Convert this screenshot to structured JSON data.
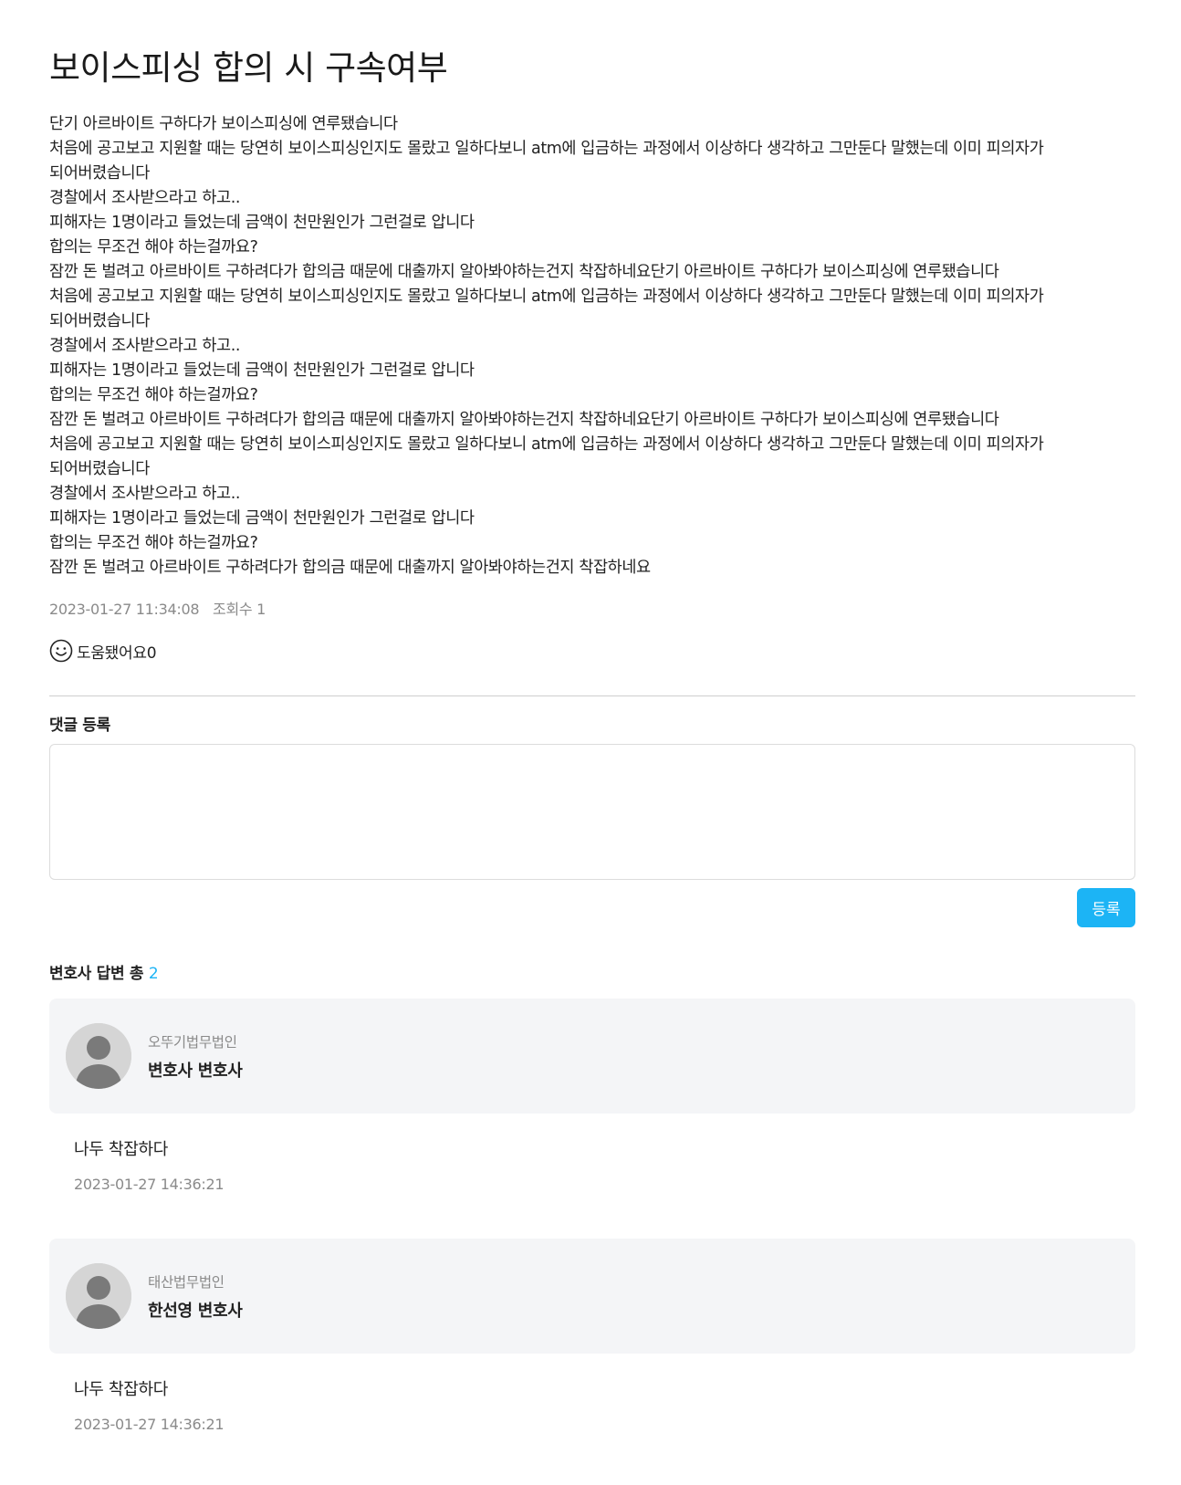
{
  "post": {
    "title": "보이스피싱 합의 시 구속여부",
    "lines": [
      "단기 아르바이트 구하다가 보이스피싱에 연루됐습니다",
      "처음에 공고보고 지원할 때는 당연히 보이스피싱인지도 몰랐고 일하다보니 atm에 입금하는 과정에서 이상하다 생각하고 그만둔다 말했는데 이미 피의자가",
      "되어버렸습니다",
      "경찰에서 조사받으라고 하고..",
      "피해자는 1명이라고 들었는데 금액이 천만원인가 그런걸로 압니다",
      "합의는 무조건 해야 하는걸까요?",
      "잠깐 돈 벌려고 아르바이트 구하려다가 합의금 때문에 대출까지 알아봐야하는건지 착잡하네요단기 아르바이트 구하다가 보이스피싱에 연루됐습니다",
      "처음에 공고보고 지원할 때는 당연히 보이스피싱인지도 몰랐고 일하다보니 atm에 입금하는 과정에서 이상하다 생각하고 그만둔다 말했는데 이미 피의자가",
      "되어버렸습니다",
      "경찰에서 조사받으라고 하고..",
      "피해자는 1명이라고 들었는데 금액이 천만원인가 그런걸로 압니다",
      "합의는 무조건 해야 하는걸까요?",
      "잠깐 돈 벌려고 아르바이트 구하려다가 합의금 때문에 대출까지 알아봐야하는건지 착잡하네요단기 아르바이트 구하다가 보이스피싱에 연루됐습니다",
      "처음에 공고보고 지원할 때는 당연히 보이스피싱인지도 몰랐고 일하다보니 atm에 입금하는 과정에서 이상하다 생각하고 그만둔다 말했는데 이미 피의자가",
      "되어버렸습니다",
      "경찰에서 조사받으라고 하고..",
      "피해자는 1명이라고 들었는데 금액이 천만원인가 그런걸로 압니다",
      "합의는 무조건 해야 하는걸까요?",
      "잠깐 돈 벌려고 아르바이트 구하려다가 합의금 때문에 대출까지 알아봐야하는건지 착잡하네요"
    ],
    "date": "2023-01-27 11:34:08",
    "views": "조회수 1",
    "helpful_label": "도움됐어요0",
    "helpful_icon": "smiley-icon"
  },
  "comment": {
    "label": "댓글 등록",
    "placeholder": "",
    "submit_label": "등록",
    "accent_color": "#1cb4f5"
  },
  "answers": {
    "heading": "변호사 답변 총",
    "count": "2",
    "items": [
      {
        "firm": "오뚜기법무법인",
        "lawyer": "변호사 변호사",
        "text": "나두 착잡하다",
        "date": "2023-01-27 14:36:21"
      },
      {
        "firm": "태산법무법인",
        "lawyer": "한선영 변호사",
        "text": "나두 착잡하다",
        "date": "2023-01-27 14:36:21"
      }
    ]
  }
}
